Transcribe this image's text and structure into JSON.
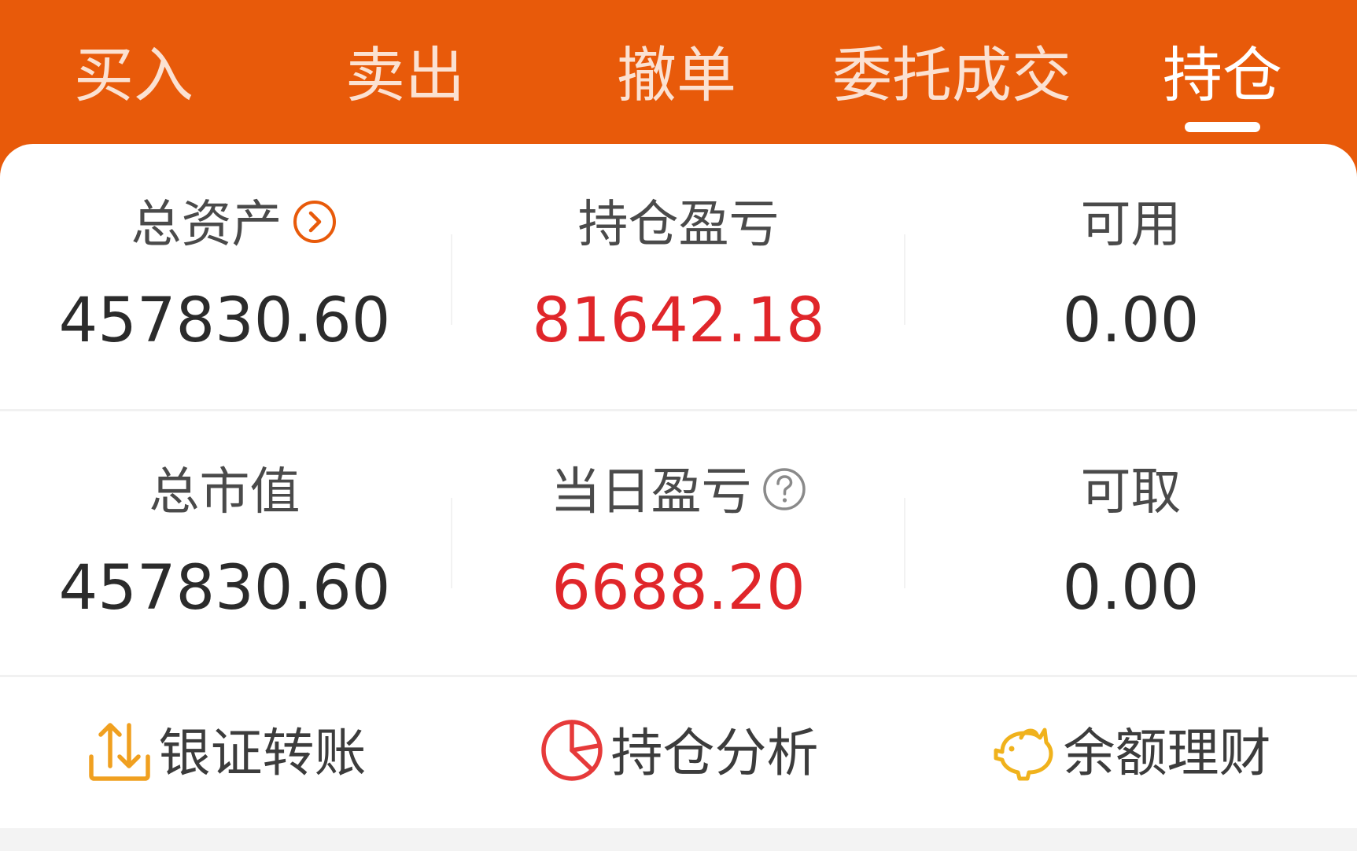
{
  "header": {
    "tabs": [
      {
        "label": "买入"
      },
      {
        "label": "卖出"
      },
      {
        "label": "撤单"
      },
      {
        "label": "委托成交"
      },
      {
        "label": "持仓"
      }
    ],
    "active_tab": "持仓"
  },
  "summary": {
    "total_assets": {
      "label": "总资产",
      "value": "457830.60"
    },
    "position_pnl": {
      "label": "持仓盈亏",
      "value": "81642.18"
    },
    "available": {
      "label": "可用",
      "value": "0.00"
    },
    "market_value": {
      "label": "总市值",
      "value": "457830.60"
    },
    "daily_pnl": {
      "label": "当日盈亏",
      "value": "6688.20"
    },
    "withdrawable": {
      "label": "可取",
      "value": "0.00"
    }
  },
  "actions": [
    {
      "label": "银证转账",
      "icon": "transfer-icon"
    },
    {
      "label": "持仓分析",
      "icon": "pie-chart-icon"
    },
    {
      "label": "余额理财",
      "icon": "piggy-bank-icon"
    }
  ],
  "colors": {
    "brand": "#e85a0a",
    "profit": "#e0262a",
    "transfer_icon": "#f0a020",
    "analysis_icon": "#e63a3a",
    "piggy_icon": "#f0b21c"
  }
}
